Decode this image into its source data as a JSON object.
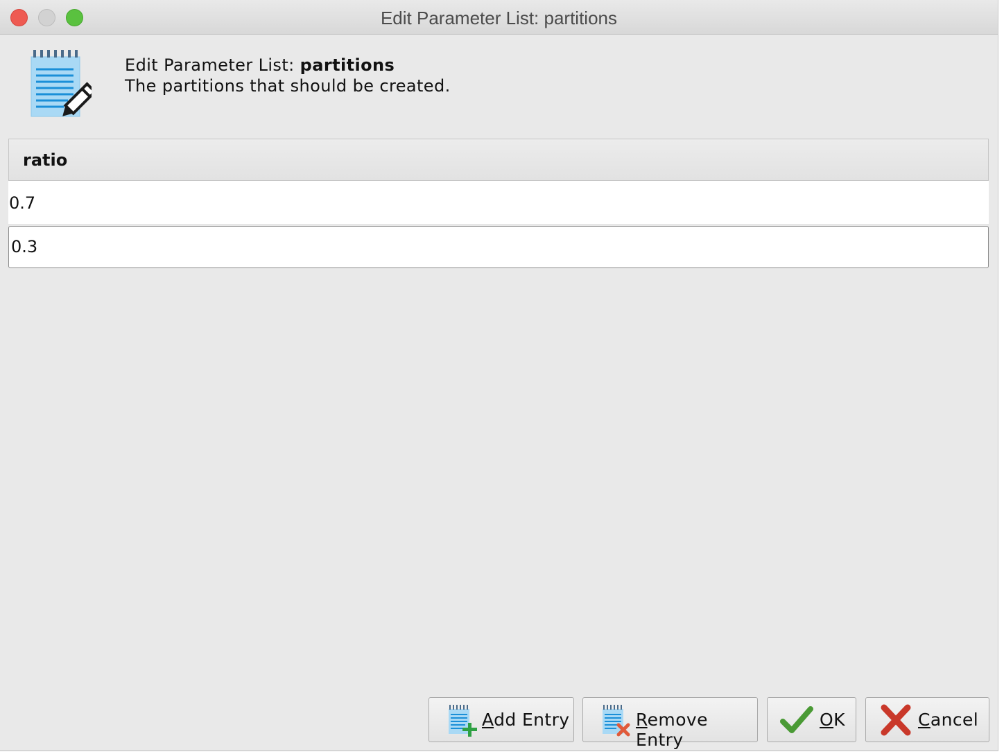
{
  "window": {
    "title": "Edit Parameter List: partitions"
  },
  "header": {
    "prefix": "Edit Parameter List: ",
    "param_name": "partitions",
    "description": "The partitions that should be created.",
    "icon": "notepad-pencil-icon"
  },
  "table": {
    "columns": [
      "ratio"
    ],
    "rows": [
      {
        "ratio": "0.7"
      },
      {
        "ratio": "0.3"
      }
    ]
  },
  "buttons": {
    "add": {
      "mnemonic": "A",
      "rest": "dd Entry",
      "icon": "notepad-add-icon"
    },
    "remove": {
      "mnemonic": "R",
      "rest": "emove Entry",
      "icon": "notepad-remove-icon"
    },
    "ok": {
      "mnemonic": "O",
      "rest": "K",
      "icon": "checkmark-icon"
    },
    "cancel": {
      "mnemonic": "C",
      "rest": "ancel",
      "icon": "red-x-icon"
    }
  },
  "colors": {
    "close": "#ee5a52",
    "minimize": "#d2d2d2",
    "maximize": "#5ac13f",
    "ok_green": "#4a9a35",
    "cancel_red": "#c9382a",
    "add_green": "#2ea043",
    "remove_red": "#e05a3a"
  }
}
